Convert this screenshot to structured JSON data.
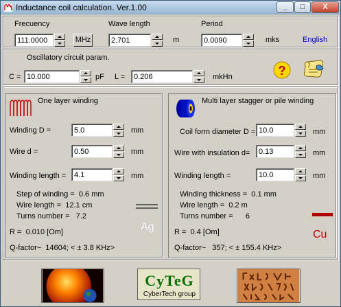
{
  "window": {
    "title": "Inductance coil calculation. Ver.1.00",
    "minimize": "_",
    "maximize": "□",
    "close": "X"
  },
  "top": {
    "frequency_label": "Frecuency",
    "frequency_value": "111.0000",
    "frequency_unit": "MHz",
    "wavelength_label": "Wave length",
    "wavelength_value": "2.701",
    "wavelength_unit": "m",
    "period_label": "Period",
    "period_value": "0.0090",
    "period_unit": "mks",
    "language_link": "English"
  },
  "osc": {
    "title": "Oscillatory circuit param.",
    "c_label": "C =",
    "c_value": "10.000",
    "c_unit": "pF",
    "l_label": "L =",
    "l_value": "0.206",
    "l_unit": "mkHn",
    "help_icon": "question-icon",
    "info_icon": "scroll-icon"
  },
  "one_layer": {
    "title": "One layer winding",
    "winding_d_label": "Winding D =",
    "winding_d_value": "5.0",
    "winding_d_unit": "mm",
    "wire_d_label": "Wire  d  =",
    "wire_d_value": "0.50",
    "wire_d_unit": "mm",
    "winding_length_label": "Winding length =",
    "winding_length_value": "4.1",
    "winding_length_unit": "mm",
    "step_label": "Step of winding =",
    "step_value": "0.6",
    "step_unit": "mm",
    "wire_length_label": "Wire  length  =",
    "wire_length_value": "12.1",
    "wire_length_unit": "cm",
    "turns_label": "Turns number  =",
    "turns_value": "7.2",
    "r_label": "R  =",
    "r_value": "0.010",
    "r_unit": "[Om]",
    "q_label": "Q-factor~",
    "q_value": "14604; < ±   3.8 KHz>",
    "material": "Ag"
  },
  "multi_layer": {
    "title": "Multi layer stagger or pile winding",
    "form_d_label": "Coil form diameter D =",
    "form_d_value": "10.0",
    "form_d_unit": "mm",
    "wire_ins_label": "Wire with insulation d=",
    "wire_ins_value": "0.13",
    "wire_ins_unit": "mm",
    "winding_length_label": "Winding length  =",
    "winding_length_value": "10.0",
    "winding_length_unit": "mm",
    "thickness_label": "Winding thickness =",
    "thickness_value": "0.1",
    "thickness_unit": "mm",
    "wire_length_label": "Wire  length  =",
    "wire_length_value": "0.2",
    "wire_length_unit": "m",
    "turns_label": "Turns number  =",
    "turns_value": "6",
    "r_label": "R  =",
    "r_value": "0.4",
    "r_unit": "[Om]",
    "q_label": "Q-factor~",
    "q_value": "357; < ± 155.4 KHz>",
    "material": "Cu"
  },
  "bottom": {
    "cyteg_logo": "CyTeG",
    "cyteg_caption": "CyberTech group"
  },
  "colors": {
    "copper": "#c00000",
    "accent_blue": "#0000c0"
  }
}
